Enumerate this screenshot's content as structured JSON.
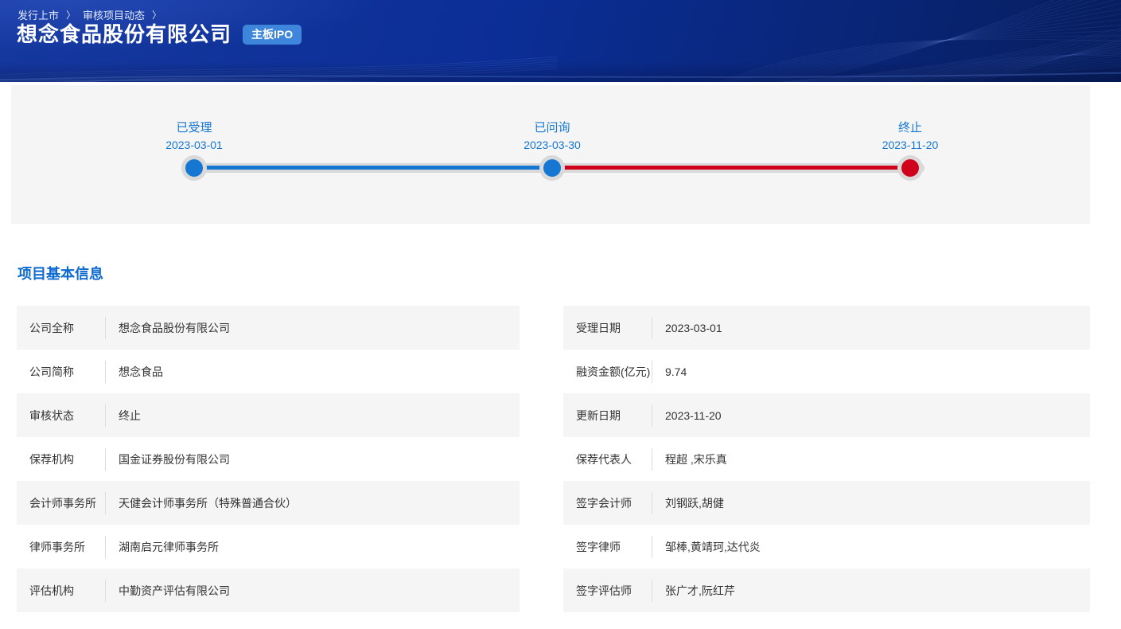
{
  "colors": {
    "timeline_blue": "#1677d2",
    "timeline_red": "#d0021b",
    "badge_bg": "#3d86dc",
    "section_title": "#0d6bd2",
    "panel_bg": "#f5f5f6",
    "text": "#333333"
  },
  "header": {
    "breadcrumb": {
      "items": [
        "发行上市",
        "审核项目动态"
      ],
      "separator": "〉"
    },
    "title": "想念食品股份有限公司",
    "badge": "主板IPO"
  },
  "timeline": {
    "milestones": [
      {
        "label": "已受理",
        "date": "2023-03-01",
        "status": "done"
      },
      {
        "label": "已问询",
        "date": "2023-03-30",
        "status": "done"
      },
      {
        "label": "终止",
        "date": "2023-11-20",
        "status": "terminated"
      }
    ]
  },
  "info": {
    "section_title": "项目基本信息",
    "left_rows": [
      {
        "label": "公司全称",
        "value": "想念食品股份有限公司"
      },
      {
        "label": "公司简称",
        "value": "想念食品"
      },
      {
        "label": "审核状态",
        "value": "终止"
      },
      {
        "label": "保荐机构",
        "value": "国金证券股份有限公司"
      },
      {
        "label": "会计师事务所",
        "value": "天健会计师事务所（特殊普通合伙）"
      },
      {
        "label": "律师事务所",
        "value": "湖南启元律师事务所"
      },
      {
        "label": "评估机构",
        "value": "中勤资产评估有限公司"
      }
    ],
    "right_rows": [
      {
        "label": "受理日期",
        "value": "2023-03-01"
      },
      {
        "label": "融资金额(亿元)",
        "value": "9.74"
      },
      {
        "label": "更新日期",
        "value": "2023-11-20"
      },
      {
        "label": "保荐代表人",
        "value": "程超 ,宋乐真"
      },
      {
        "label": "签字会计师",
        "value": "刘钢跃,胡健"
      },
      {
        "label": "签字律师",
        "value": "邹棒,黄靖珂,达代炎"
      },
      {
        "label": "签字评估师",
        "value": "张广才,阮红芹"
      }
    ]
  }
}
